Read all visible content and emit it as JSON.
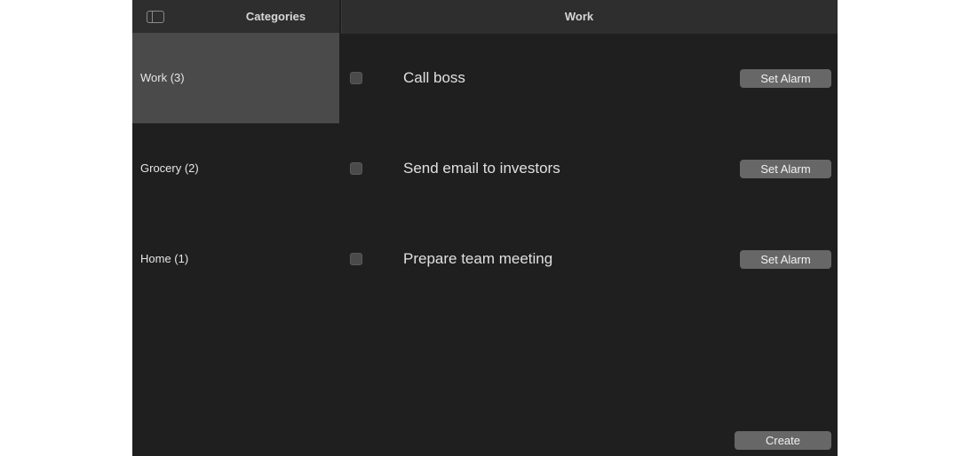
{
  "sidebar": {
    "title": "Categories",
    "toggle_icon": "sidebar-toggle-icon",
    "items": [
      {
        "label": "Work (3)",
        "selected": true
      },
      {
        "label": "Grocery (2)",
        "selected": false
      },
      {
        "label": "Home (1)",
        "selected": false
      }
    ]
  },
  "main": {
    "title": "Work",
    "tasks": [
      {
        "title": "Call boss",
        "checked": false,
        "alarm_label": "Set Alarm"
      },
      {
        "title": "Send email to investors",
        "checked": false,
        "alarm_label": "Set Alarm"
      },
      {
        "title": "Prepare team meeting",
        "checked": false,
        "alarm_label": "Set Alarm"
      }
    ],
    "create_label": "Create"
  },
  "colors": {
    "background": "#1f1f1f",
    "header": "#2e2e2e",
    "selected_row": "#4a4a4a",
    "button": "#676767",
    "text": "#e6e6e6"
  }
}
